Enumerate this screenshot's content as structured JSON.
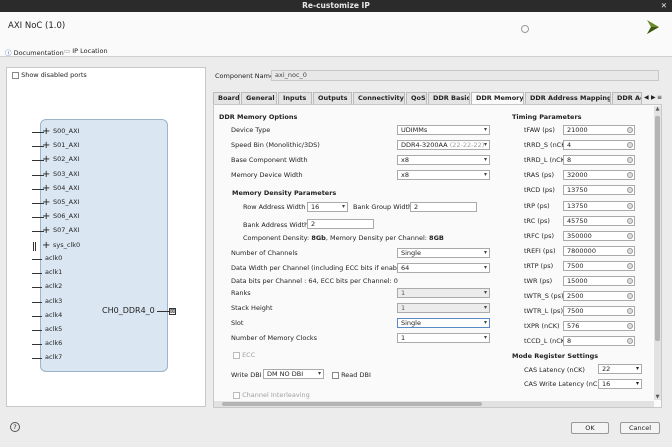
{
  "window": {
    "title": "Re-customize IP",
    "close": "✕"
  },
  "header": {
    "ip_title": "AXI NoC (1.0)"
  },
  "doc_links": {
    "documentation": "Documentation",
    "ip_location": "IP Location"
  },
  "left": {
    "show_disabled": "Show disabled ports",
    "axi_ports": [
      "S00_AXI",
      "S01_AXI",
      "S02_AXI",
      "S03_AXI",
      "S04_AXI",
      "S05_AXI",
      "S06_AXI",
      "S07_AXI"
    ],
    "sys_clk": "sys_clk0",
    "output_port": "CH0_DDR4_0",
    "aclks": [
      "aclk0",
      "aclk1",
      "aclk2",
      "aclk3",
      "aclk4",
      "aclk5",
      "aclk6",
      "aclk7"
    ]
  },
  "component_name": {
    "label": "Component Name",
    "value": "axi_noc_0"
  },
  "tabs": [
    "Board",
    "General",
    "Inputs",
    "Outputs",
    "Connectivity",
    "QoS",
    "DDR Basic",
    "DDR Memory",
    "DDR Address Mapping",
    "DDR Ad"
  ],
  "active_tab": "DDR Memory",
  "tab_nav": {
    "prev": "◀",
    "next": "▶",
    "menu": "≡"
  },
  "ddr_memory": {
    "section_title": "DDR Memory Options",
    "device_type": {
      "label": "Device Type",
      "value": "UDIMMs"
    },
    "speed_bin": {
      "label": "Speed Bin (Monolithic/3DS)",
      "value": "DDR4-3200AA",
      "suffix": "(22-22-22)"
    },
    "base_component_width": {
      "label": "Base Component Width",
      "value": "x8"
    },
    "memory_device_width": {
      "label": "Memory Device Width",
      "value": "x8"
    },
    "density_title": "Memory Density Parameters",
    "row_address_width": {
      "label": "Row Address Width",
      "value": "16"
    },
    "bank_group_width": {
      "label": "Bank Group Width",
      "value": "2"
    },
    "bank_address_width": {
      "label": "Bank Address Width",
      "value": "2"
    },
    "component_density_prefix": "Component Density: ",
    "component_density_value": "8Gb",
    "memory_density_prefix": ", Memory Density per Channel: ",
    "memory_density_value": "8GB",
    "num_channels": {
      "label": "Number of Channels",
      "value": "Single"
    },
    "data_width": {
      "label": "Data Width per Channel (including ECC bits if enabled)",
      "value": "64"
    },
    "data_bits_info": "Data bits per Channel : 64, ECC bits per Channel: 0",
    "ranks": {
      "label": "Ranks",
      "value": "1"
    },
    "stack_height": {
      "label": "Stack Height",
      "value": "1"
    },
    "slot": {
      "label": "Slot",
      "value": "Single"
    },
    "num_memory_clocks": {
      "label": "Number of Memory Clocks",
      "value": "1"
    },
    "ecc": "ECC",
    "write_dbi": {
      "label": "Write DBI",
      "value": "DM NO DBI"
    },
    "read_dbi": "Read DBI",
    "channel_interleaving": "Channel Interleaving"
  },
  "timing": {
    "section_title": "Timing Parameters",
    "rows": [
      {
        "label": "tFAW (ps)",
        "value": "21000"
      },
      {
        "label": "tRRD_S (nCK)",
        "value": "4"
      },
      {
        "label": "tRRD_L (nCK)",
        "value": "8"
      },
      {
        "label": "tRAS (ps)",
        "value": "32000"
      },
      {
        "label": "tRCD (ps)",
        "value": "13750"
      },
      {
        "label": "tRP (ps)",
        "value": "13750"
      },
      {
        "label": "tRC (ps)",
        "value": "45750"
      },
      {
        "label": "tRFC (ps)",
        "value": "350000"
      },
      {
        "label": "tREFI (ps)",
        "value": "7800000"
      },
      {
        "label": "tRTP (ps)",
        "value": "7500"
      },
      {
        "label": "tWR (ps)",
        "value": "15000"
      },
      {
        "label": "tWTR_S (ps)",
        "value": "2500"
      },
      {
        "label": "tWTR_L (ps)",
        "value": "7500"
      },
      {
        "label": "tXPR (nCK)",
        "value": "576"
      },
      {
        "label": "tCCD_L (nCK)",
        "value": "8"
      }
    ],
    "mode_title": "Mode Register Settings",
    "cas_latency": {
      "label": "CAS Latency (nCK)",
      "value": "22"
    },
    "cas_write_latency": {
      "label": "CAS Write Latency (nCK)",
      "value": "16"
    }
  },
  "footer": {
    "help": "?",
    "ok": "OK",
    "cancel": "Cancel"
  },
  "colors": {
    "block_fill": "#dae6f2",
    "logo_green": "#6a8a2a",
    "density_blue": "#1a1a1a"
  }
}
